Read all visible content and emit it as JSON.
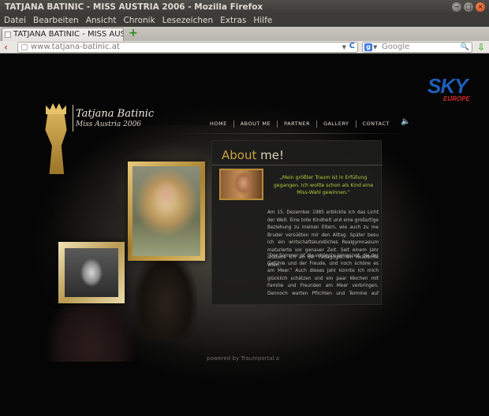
{
  "window": {
    "title": "TATJANA BATINIC - MISS AUSTRIA 2006 - Mozilla Firefox",
    "controls": [
      "−",
      "□",
      "×"
    ]
  },
  "menu": [
    "Datei",
    "Bearbeiten",
    "Ansicht",
    "Chronik",
    "Lesezeichen",
    "Extras",
    "Hilfe"
  ],
  "tab": {
    "label": "TATJANA BATINIC - MISS AUST...",
    "new_tab": "+"
  },
  "navbar": {
    "url": "www.tatjana-batinic.at",
    "search_placeholder": "Google",
    "search_engine": "g",
    "back": "‹",
    "reload": "C",
    "download": "⇩"
  },
  "site": {
    "logo_name": "Tatjana Batinic",
    "logo_sub": "Miss Austria 2006",
    "sponsor": {
      "sky": "SKY",
      "europe": "EUROPE"
    },
    "nav": [
      "HOME",
      "ABOUT ME",
      "PARTNER",
      "GALLERY",
      "CONTACT"
    ],
    "about": {
      "title_accent": "About",
      "title_rest": " me!",
      "quote": "„Mein größter Traum ist in Erfüllung gegangen. Ich wollte schon als Kind eine Miss-Wahl gewinnen.\"",
      "p1": "Am 15. Dezember 1985 erblickte ich das Licht der Welt. Eine tolle Kindheit und eine großartige Beziehung zu meinen Eltern, wie auch zu me Bruder versüßten mir den Alltag. Später besu ich ein wirtschaftskundliches Realgymnasium maturierte vor genauer Zeit. Seit einem Jahr studiere ich an der Pädagogischen Akademie Wien.",
      "p2": "\"Der Sommer ist die schönste Jahreszeit, die der Gefühle und der Freude, und noch schöne es am Meer.\" Auch dieses Jahr konnte ich mich glücklich schätzen und ein paar Wochen mit Familie und Freunden am Meer verbringen. Dennoch warten Pflichten und Termine auf mich. ... Die Miss World Wahl ist zum Greifen n"
    },
    "powered": "powered by Traumportal.a"
  },
  "colors": {
    "quote": "#b7ca3a",
    "title_accent": "#c7a23d",
    "sky_blue": "#1d5fb8",
    "europe_red": "#d42a2a"
  }
}
